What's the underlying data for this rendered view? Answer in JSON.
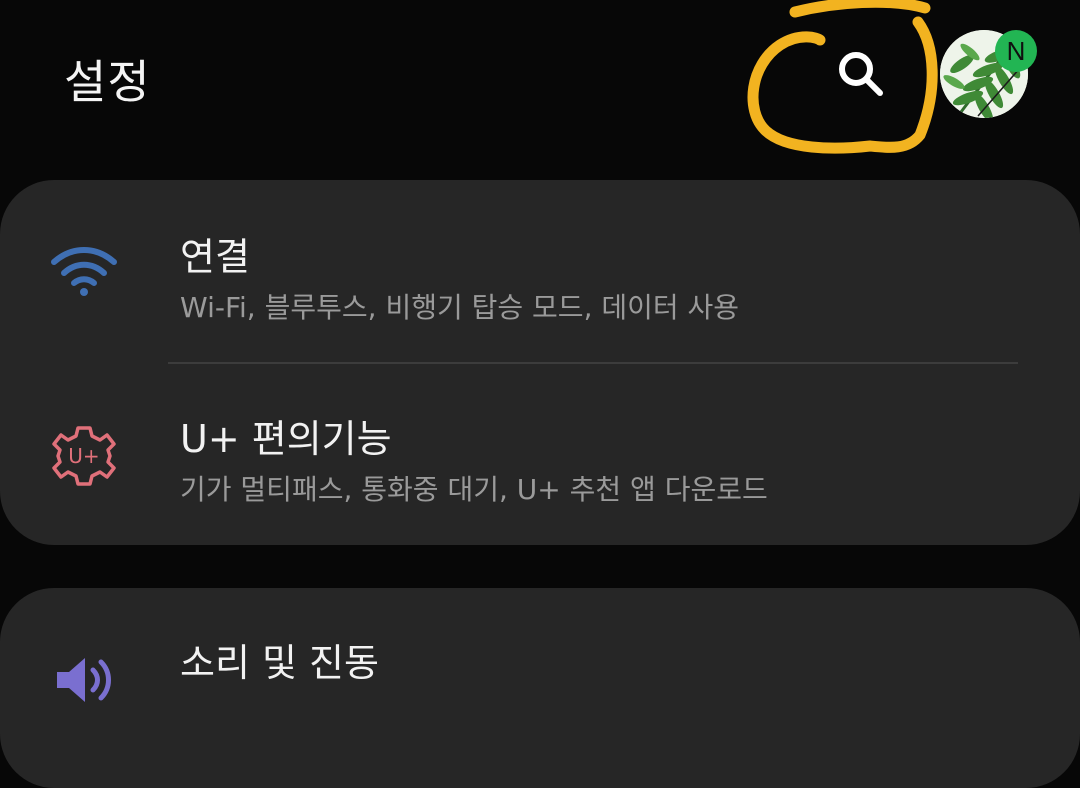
{
  "header": {
    "title": "설정",
    "avatar_badge": "N"
  },
  "icons": {
    "search": "search-icon",
    "wifi": "wifi-icon",
    "uplus": "uplus-gear-icon",
    "sound": "volume-icon",
    "avatar": "fern-leaf-avatar"
  },
  "colors": {
    "background": "#070707",
    "card": "#262626",
    "wifi_icon": "#3f6fb3",
    "uplus_icon": "#e0707a",
    "sound_icon": "#7a6fd0",
    "annotation": "#f2b320",
    "badge": "#22b553"
  },
  "settings": {
    "connections": {
      "title": "연결",
      "subtitle": "Wi-Fi, 블루투스, 비행기 탑승 모드, 데이터 사용"
    },
    "uplus": {
      "title": "U+ 편의기능",
      "subtitle": "기가 멀티패스, 통화중 대기, U+ 추천 앱 다운로드"
    },
    "sound": {
      "title": "소리 및 진동"
    }
  }
}
